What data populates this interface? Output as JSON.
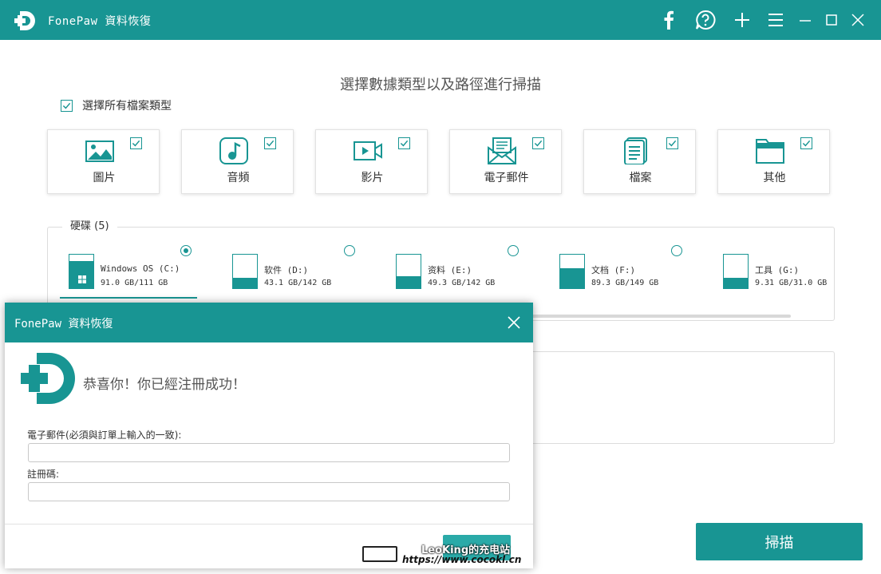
{
  "colors": {
    "accent": "#189593",
    "button": "#2aaaa8"
  },
  "app": {
    "title": "FonePaw 資料恢復"
  },
  "titlebar": {
    "buttons": [
      "facebook-icon",
      "help-icon",
      "plus-icon",
      "menu-icon",
      "minimize-icon",
      "maximize-icon",
      "close-icon"
    ]
  },
  "main": {
    "heading": "選擇數據類型以及路徑進行掃描",
    "select_all": {
      "label": "選擇所有檔案類型",
      "checked": true
    },
    "types": [
      {
        "label": "圖片",
        "icon": "image-icon",
        "checked": true
      },
      {
        "label": "音頻",
        "icon": "music-icon",
        "checked": true
      },
      {
        "label": "影片",
        "icon": "video-icon",
        "checked": true
      },
      {
        "label": "電子郵件",
        "icon": "email-icon",
        "checked": true
      },
      {
        "label": "檔案",
        "icon": "document-icon",
        "checked": true
      },
      {
        "label": "其他",
        "icon": "folder-icon",
        "checked": true
      }
    ],
    "disks_legend": "硬碟 (5)",
    "disks": [
      {
        "name": "Windows OS (C:)",
        "size": "91.0 GB/111 GB",
        "used": 0.82,
        "selected": true
      },
      {
        "name": "软件 (D:)",
        "size": "43.1 GB/142 GB",
        "used": 0.3,
        "selected": false
      },
      {
        "name": "资料 (E:)",
        "size": "49.3 GB/142 GB",
        "used": 0.35,
        "selected": false
      },
      {
        "name": "文档 (F:)",
        "size": "89.3 GB/149 GB",
        "used": 0.6,
        "selected": false
      },
      {
        "name": "工具 (G:)",
        "size": "9.31 GB/31.0 GB",
        "used": 0.3,
        "selected": false
      }
    ],
    "scan_label": "掃描"
  },
  "dialog": {
    "title": "FonePaw 資料恢復",
    "message": "恭喜你！你已經注冊成功！",
    "email_label": "電子郵件(必須與訂單上輸入的一致):",
    "email_value": "",
    "code_label": "註冊碼:",
    "code_value": ""
  },
  "watermark": {
    "line1": "LeoKing的充电站",
    "line2": "https://www.cocokl.cn"
  }
}
